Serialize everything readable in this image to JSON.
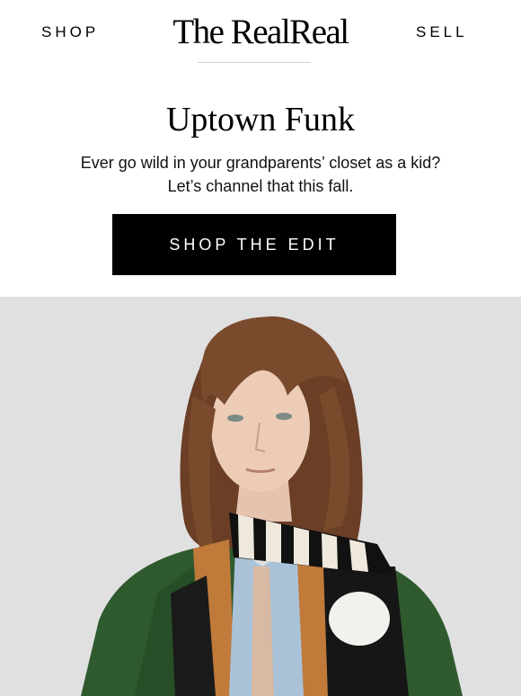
{
  "nav": {
    "left_label": "SHOP",
    "brand": "The RealReal",
    "right_label": "SELL"
  },
  "hero": {
    "headline": "Uptown Funk",
    "subcopy_line1": "Ever go wild in your grandparents’ closet as a kid?",
    "subcopy_line2": "Let’s channel that this fall.",
    "cta_label": "SHOP THE EDIT"
  },
  "colors": {
    "background": "#ffffff",
    "text": "#000000",
    "cta_bg": "#000000",
    "cta_text": "#ffffff",
    "divider": "#cfcfcf",
    "photo_backdrop": "#e3e3e5",
    "jacket_green": "#2f5a2e",
    "scarf_black": "#111111",
    "scarf_cream": "#efe9dd",
    "cardigan_orange": "#c07a3a",
    "shirt_blue": "#a9c2d8",
    "hair_brown": "#7a4a2c"
  },
  "images": {
    "hero_photo": "model-in-green-jacket-striped-scarf-photo"
  }
}
